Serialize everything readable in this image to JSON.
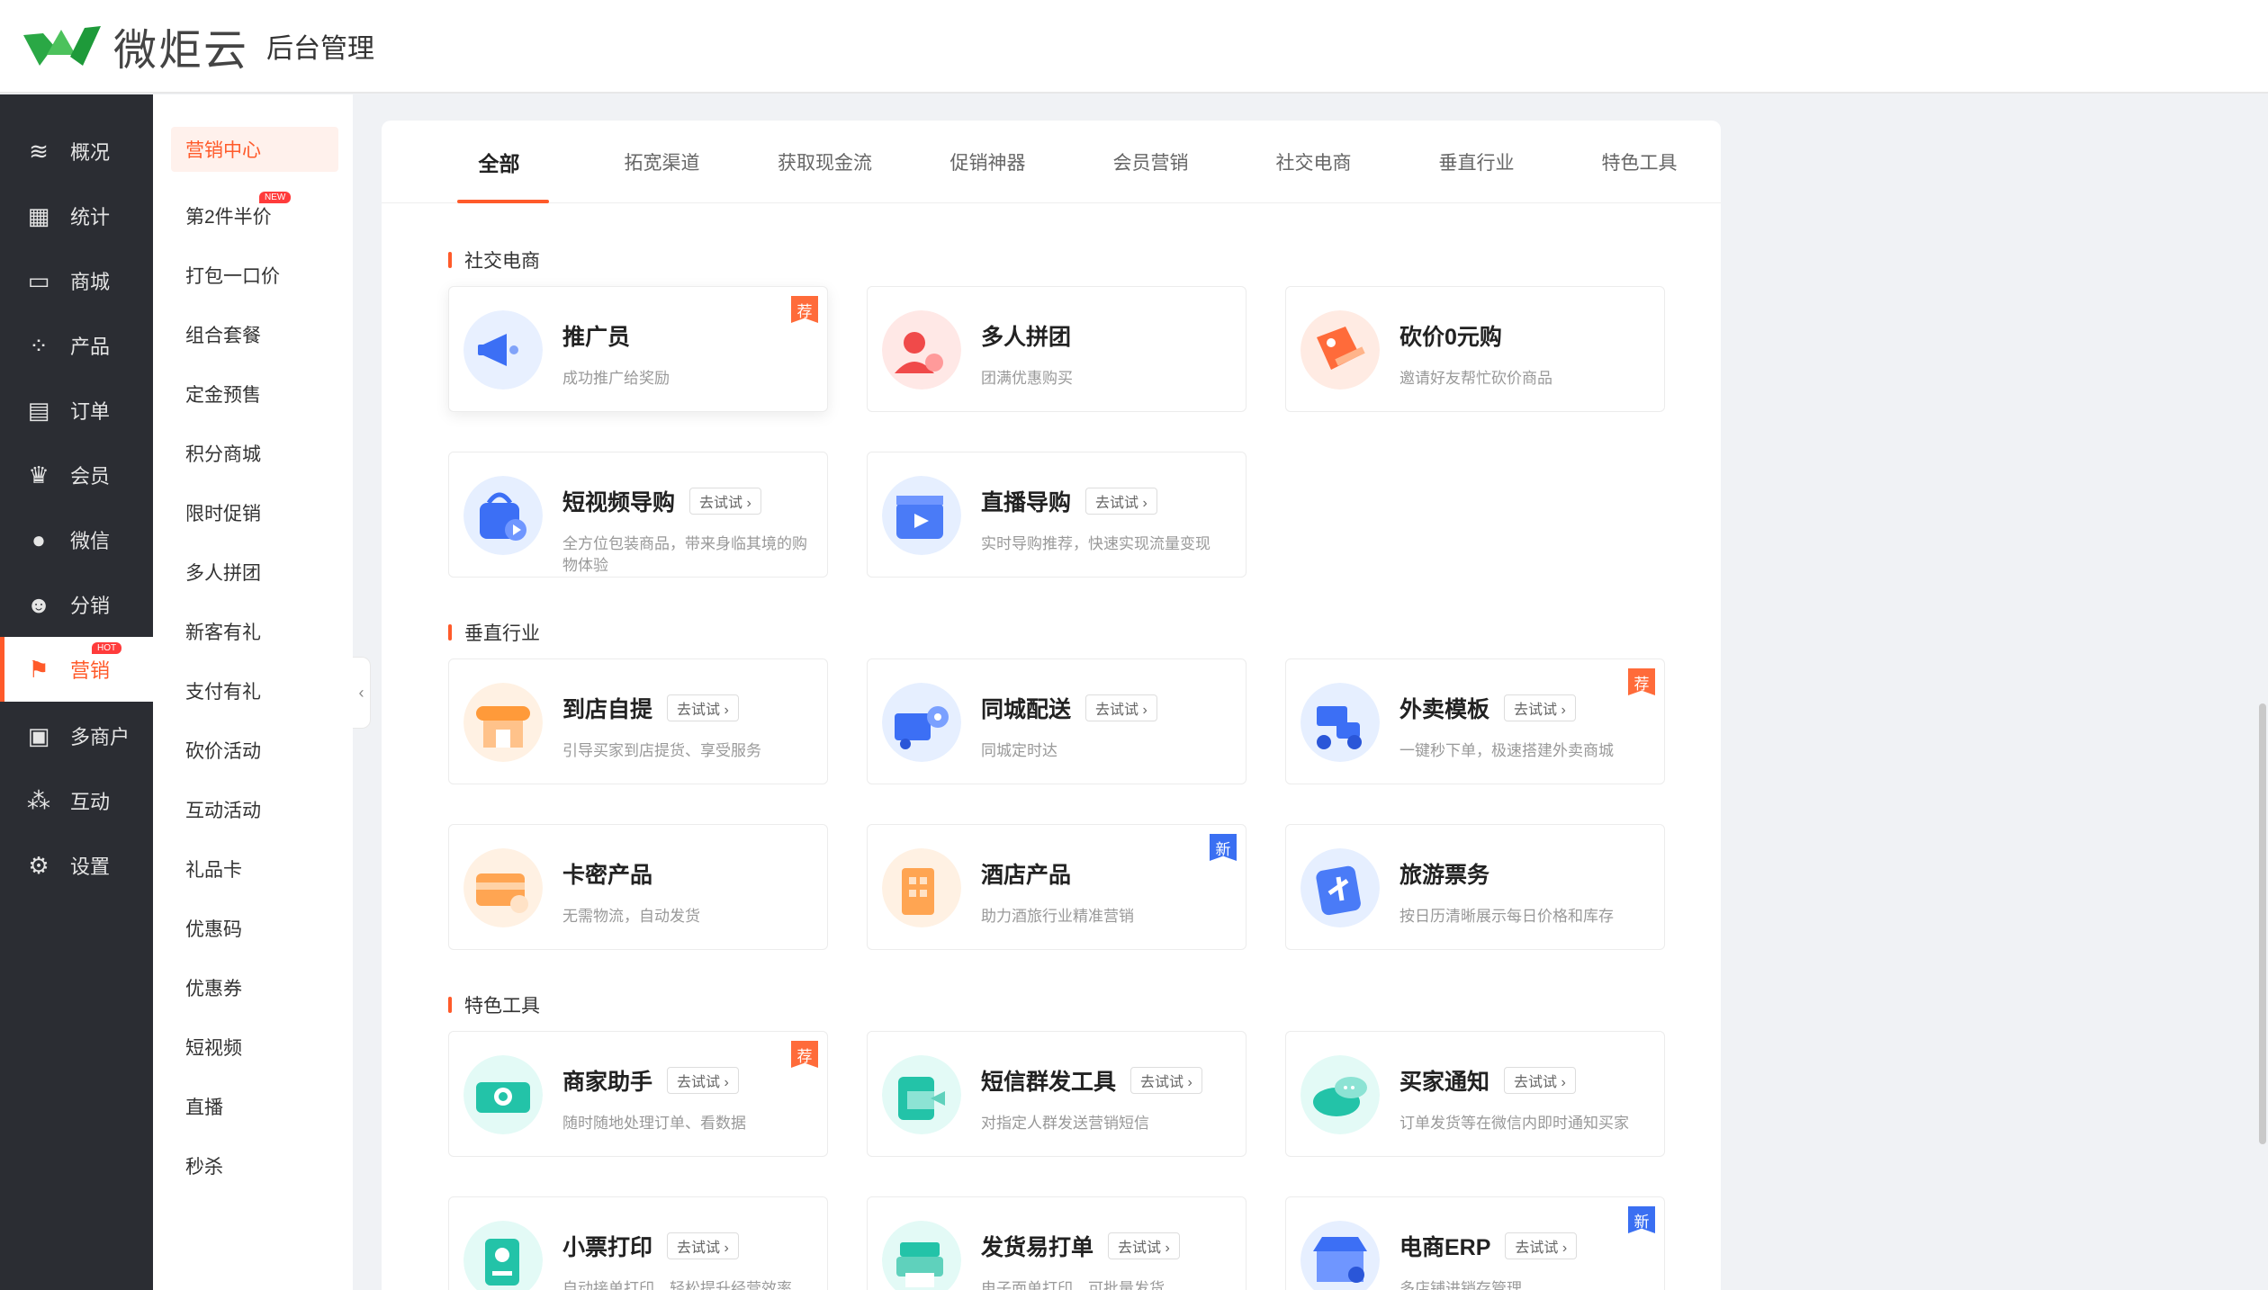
{
  "header": {
    "logo_text": "微炬云",
    "subtitle": "后台管理"
  },
  "leftnav": [
    {
      "label": "概况",
      "icon": "layers-icon",
      "glyph": "≋"
    },
    {
      "label": "统计",
      "icon": "chart-icon",
      "glyph": "▦"
    },
    {
      "label": "商城",
      "icon": "store-icon",
      "glyph": "▭"
    },
    {
      "label": "产品",
      "icon": "grid-icon",
      "glyph": "⁘"
    },
    {
      "label": "订单",
      "icon": "order-icon",
      "glyph": "▤"
    },
    {
      "label": "会员",
      "icon": "crown-icon",
      "glyph": "♛"
    },
    {
      "label": "微信",
      "icon": "wechat-icon",
      "glyph": "●"
    },
    {
      "label": "分销",
      "icon": "users-icon",
      "glyph": "☻"
    },
    {
      "label": "营销",
      "icon": "flag-icon",
      "glyph": "⚑",
      "active": true,
      "badge": "HOT"
    },
    {
      "label": "多商户",
      "icon": "merchant-icon",
      "glyph": "▣"
    },
    {
      "label": "互动",
      "icon": "interact-icon",
      "glyph": "⁂"
    },
    {
      "label": "设置",
      "icon": "gear-icon",
      "glyph": "⚙"
    }
  ],
  "subnav": [
    {
      "label": "营销中心",
      "active": true
    },
    {
      "label": "第2件半价",
      "badge": "NEW"
    },
    {
      "label": "打包一口价"
    },
    {
      "label": "组合套餐"
    },
    {
      "label": "定金预售"
    },
    {
      "label": "积分商城"
    },
    {
      "label": "限时促销"
    },
    {
      "label": "多人拼团"
    },
    {
      "label": "新客有礼"
    },
    {
      "label": "支付有礼"
    },
    {
      "label": "砍价活动"
    },
    {
      "label": "互动活动"
    },
    {
      "label": "礼品卡"
    },
    {
      "label": "优惠码"
    },
    {
      "label": "优惠券"
    },
    {
      "label": "短视频"
    },
    {
      "label": "直播"
    },
    {
      "label": "秒杀"
    }
  ],
  "collapse_glyph": "‹",
  "tabs": [
    "全部",
    "拓宽渠道",
    "获取现金流",
    "促销神器",
    "会员营销",
    "社交电商",
    "垂直行业",
    "特色工具"
  ],
  "sections": [
    {
      "title": "社交电商"
    },
    {
      "title": "垂直行业"
    },
    {
      "title": "特色工具"
    }
  ],
  "try_label": "去试试 ›",
  "rec_label": "荐",
  "new_label": "新",
  "cards": [
    {
      "title": "推广员",
      "desc": "成功推广给奖励",
      "try": false,
      "corner": "rec",
      "color1": "#e8f0ff",
      "color2": "#3c6ff5"
    },
    {
      "title": "多人拼团",
      "desc": "团满优惠购买",
      "try": false,
      "color1": "#ffe8e6",
      "color2": "#f04a4a"
    },
    {
      "title": "砍价0元购",
      "desc": "邀请好友帮忙砍价商品",
      "try": false,
      "color1": "#ffebe3",
      "color2": "#ff6b3a"
    },
    {
      "title": "短视频导购",
      "desc": "全方位包装商品，带来身临其境的购物体验",
      "try": true,
      "color1": "#e6efff",
      "color2": "#3c6ff5"
    },
    {
      "title": "直播导购",
      "desc": "实时导购推荐，快速实现流量变现",
      "try": true,
      "color1": "#e6efff",
      "color2": "#4a7bf7"
    },
    {
      "title": "到店自提",
      "desc": "引导买家到店提货、享受服务",
      "try": true,
      "color1": "#fff1e3",
      "color2": "#ff9a3a"
    },
    {
      "title": "同城配送",
      "desc": "同城定时达",
      "try": true,
      "color1": "#e6efff",
      "color2": "#3c6ff5"
    },
    {
      "title": "外卖模板",
      "desc": "一键秒下单，极速搭建外卖商城",
      "try": true,
      "corner": "rec",
      "color1": "#e6efff",
      "color2": "#3c6ff5"
    },
    {
      "title": "卡密产品",
      "desc": "无需物流，自动发货",
      "try": false,
      "color1": "#fff1e3",
      "color2": "#ffa552"
    },
    {
      "title": "酒店产品",
      "desc": "助力酒旅行业精准营销",
      "try": false,
      "corner": "new",
      "color1": "#fff1e3",
      "color2": "#ffa552"
    },
    {
      "title": "旅游票务",
      "desc": "按日历清晰展示每日价格和库存",
      "try": false,
      "color1": "#e6efff",
      "color2": "#4a7bf7"
    },
    {
      "title": "商家助手",
      "desc": "随时随地处理订单、看数据",
      "try": true,
      "corner": "rec",
      "color1": "#e3faf6",
      "color2": "#23c3a8"
    },
    {
      "title": "短信群发工具",
      "desc": "对指定人群发送营销短信",
      "try": true,
      "color1": "#e3faf6",
      "color2": "#23c3a8"
    },
    {
      "title": "买家通知",
      "desc": "订单发货等在微信内即时通知买家",
      "try": true,
      "color1": "#e3faf6",
      "color2": "#23c3a8"
    },
    {
      "title": "小票打印",
      "desc": "自动接单打印，轻松提升经营效率",
      "try": true,
      "color1": "#e3faf6",
      "color2": "#23c3a8"
    },
    {
      "title": "发货易打单",
      "desc": "电子面单打印，可批量发货",
      "try": true,
      "color1": "#e3faf6",
      "color2": "#23c3a8"
    },
    {
      "title": "电商ERP",
      "desc": "多店铺进销存管理",
      "try": true,
      "corner": "new",
      "color1": "#e6efff",
      "color2": "#3c6ff5"
    }
  ]
}
